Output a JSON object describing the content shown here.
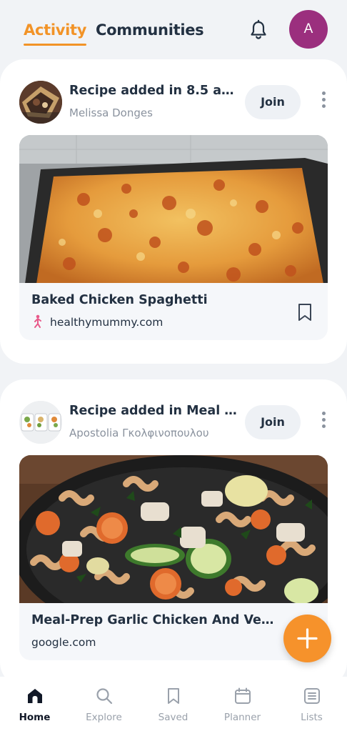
{
  "header": {
    "tabs": [
      {
        "label": "Activity",
        "active": true
      },
      {
        "label": "Communities",
        "active": false
      }
    ],
    "notification_icon": "bell-icon",
    "avatar_letter": "A",
    "avatar_color": "#9b2f7e"
  },
  "feed": [
    {
      "title_prefix": "Recipe added in ",
      "title_strong": "8.5 an...",
      "user": "Melissa Donges",
      "join_label": "Join",
      "recipe_name": "Baked Chicken Spaghetti",
      "source": "healthymummy.com",
      "source_icon": "figure-icon",
      "bookmark_icon": "bookmark-icon"
    },
    {
      "title_prefix": "Recipe added in ",
      "title_strong": "Meal P...",
      "user": "Apostolia Γκολφινοπουλου",
      "join_label": "Join",
      "recipe_name": "Meal-Prep Garlic Chicken And Veg...",
      "source": "google.com"
    }
  ],
  "fab": {
    "icon": "plus-icon",
    "color": "#f6922b"
  },
  "bottom_nav": [
    {
      "label": "Home",
      "icon": "home-icon",
      "active": true
    },
    {
      "label": "Explore",
      "icon": "search-icon",
      "active": false
    },
    {
      "label": "Saved",
      "icon": "bookmark-icon",
      "active": false
    },
    {
      "label": "Planner",
      "icon": "calendar-icon",
      "active": false
    },
    {
      "label": "Lists",
      "icon": "list-icon",
      "active": false
    }
  ],
  "colors": {
    "accent": "#f29327",
    "text_dark": "#233142",
    "text_muted": "#8a929e",
    "background": "#f1f3f6"
  }
}
